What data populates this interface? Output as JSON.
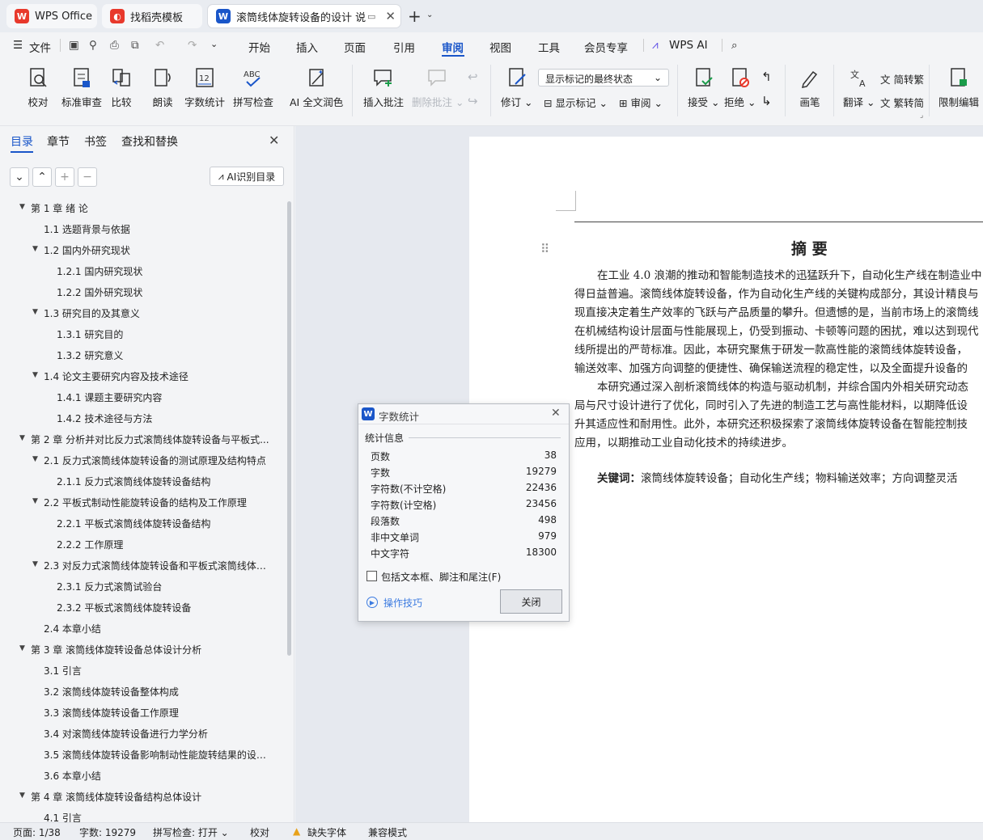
{
  "tabs": [
    {
      "label": "WPS Office",
      "icon": "wps-logo-icon"
    },
    {
      "label": "找稻壳模板",
      "icon": "docer-icon"
    },
    {
      "label": "滚筒线体旋转设备的设计 说明",
      "icon": "writer-doc-icon"
    }
  ],
  "menu": {
    "file": "文件",
    "items": [
      "开始",
      "插入",
      "页面",
      "引用",
      "审阅",
      "视图",
      "工具",
      "会员专享"
    ],
    "ai": "WPS AI"
  },
  "ribbon": {
    "proofread": "校对",
    "std_review": "标准审查",
    "compare": "比较",
    "read_aloud": "朗读",
    "word_count": "字数统计",
    "spell_check": "拼写检查",
    "ai_polish": "AI 全文润色",
    "insert_comment": "插入批注",
    "delete_comment": "删除批注",
    "revise": "修订",
    "markup_select": "显示标记的最终状态",
    "show_markup": "显示标记",
    "review": "审阅",
    "accept": "接受",
    "reject": "拒绝",
    "pen": "画笔",
    "translate": "翻译",
    "to_trad": "简转繁",
    "to_simp": "繁转简",
    "restrict": "限制编辑"
  },
  "nav": {
    "tabs": [
      "目录",
      "章节",
      "书签",
      "查找和替换"
    ],
    "ai_toc": "AI识别目录",
    "toc": [
      {
        "text": "第 1 章  绪    论",
        "level": 1,
        "arrow": true
      },
      {
        "text": "1.1 选题背景与依据",
        "level": 2,
        "arrow": false
      },
      {
        "text": "1.2 国内外研究现状",
        "level": 2,
        "arrow": true
      },
      {
        "text": "1.2.1 国内研究现状",
        "level": 3,
        "arrow": false
      },
      {
        "text": "1.2.2 国外研究现状",
        "level": 3,
        "arrow": false
      },
      {
        "text": "1.3 研究目的及其意义",
        "level": 2,
        "arrow": true
      },
      {
        "text": "1.3.1 研究目的",
        "level": 3,
        "arrow": false
      },
      {
        "text": "1.3.2 研究意义",
        "level": 3,
        "arrow": false
      },
      {
        "text": "1.4  论文主要研究内容及技术途径",
        "level": 2,
        "arrow": true
      },
      {
        "text": "1.4.1  课题主要研究内容",
        "level": 3,
        "arrow": false
      },
      {
        "text": "1.4.2  技术途径与方法",
        "level": 3,
        "arrow": false
      },
      {
        "text": "第 2 章  分析并对比反力式滚筒线体旋转设备与平板式...",
        "level": 1,
        "arrow": true
      },
      {
        "text": "2.1  反力式滚筒线体旋转设备的测试原理及结构特点",
        "level": 2,
        "arrow": true
      },
      {
        "text": "2.1.1  反力式滚筒线体旋转设备结构",
        "level": 3,
        "arrow": false
      },
      {
        "text": "2.2  平板式制动性能旋转设备的结构及工作原理",
        "level": 2,
        "arrow": true
      },
      {
        "text": "2.2.1  平板式滚筒线体旋转设备结构",
        "level": 3,
        "arrow": false
      },
      {
        "text": "2.2.2  工作原理",
        "level": 3,
        "arrow": false
      },
      {
        "text": "2.3 对反力式滚筒线体旋转设备和平板式滚筒线体旋...",
        "level": 2,
        "arrow": true
      },
      {
        "text": "2.3.1  反力式滚筒试验台",
        "level": 3,
        "arrow": false
      },
      {
        "text": "2.3.2  平板式滚筒线体旋转设备",
        "level": 3,
        "arrow": false
      },
      {
        "text": "2.4  本章小结",
        "level": 2,
        "arrow": false
      },
      {
        "text": "第 3 章   滚筒线体旋转设备总体设计分析",
        "level": 1,
        "arrow": true
      },
      {
        "text": "3.1  引言",
        "level": 2,
        "arrow": false
      },
      {
        "text": "3.2 滚筒线体旋转设备整体构成",
        "level": 2,
        "arrow": false
      },
      {
        "text": "3.3  滚筒线体旋转设备工作原理",
        "level": 2,
        "arrow": false
      },
      {
        "text": "3.4  对滚筒线体旋转设备进行力学分析",
        "level": 2,
        "arrow": false
      },
      {
        "text": "3.5  滚筒线体旋转设备影响制动性能旋转结果的设计 ...",
        "level": 2,
        "arrow": false
      },
      {
        "text": "3.6  本章小结",
        "level": 2,
        "arrow": false
      },
      {
        "text": "第 4 章  滚筒线体旋转设备结构总体设计",
        "level": 1,
        "arrow": true
      },
      {
        "text": "4.1  引言",
        "level": 2,
        "arrow": false
      }
    ]
  },
  "doc": {
    "heading": "摘  要",
    "lines": [
      "在工业 4.0 浪潮的推动和智能制造技术的迅猛跃升下，自动化生产线在制造业中",
      "得日益普遍。滚筒线体旋转设备，作为自动化生产线的关键构成部分，其设计精良与",
      "现直接决定着生产效率的飞跃与产品质量的攀升。但遗憾的是，当前市场上的滚筒线",
      "在机械结构设计层面与性能展现上，仍受到振动、卡顿等问题的困扰，难以达到现代",
      "线所提出的严苛标准。因此，本研究聚焦于研发一款高性能的滚筒线体旋转设备，",
      "输送效率、加强方向调整的便捷性、确保输送流程的稳定性，以及全面提升设备的",
      "本研究通过深入剖析滚筒线体的构造与驱动机制，并综合国内外相关研究动态",
      "局与尺寸设计进行了优化，同时引入了先进的制造工艺与高性能材料，以期降低设",
      "升其适应性和耐用性。此外，本研究还积极探索了滚筒线体旋转设备在智能控制技",
      "应用，以期推动工业自动化技术的持续进步。"
    ],
    "kw_label": "关键词：",
    "kw_text": "滚筒线体旋转设备；自动化生产线；物料输送效率；方向调整灵活"
  },
  "dialog": {
    "title": "字数统计",
    "section": "统计信息",
    "stats": [
      {
        "label": "页数",
        "value": "38"
      },
      {
        "label": "字数",
        "value": "19279"
      },
      {
        "label": "字符数(不计空格)",
        "value": "22436"
      },
      {
        "label": "字符数(计空格)",
        "value": "23456"
      },
      {
        "label": "段落数",
        "value": "498"
      },
      {
        "label": "非中文单词",
        "value": "979"
      },
      {
        "label": "中文字符",
        "value": "18300"
      }
    ],
    "checkbox": "包括文本框、脚注和尾注(F)",
    "tips": "操作技巧",
    "close": "关闭"
  },
  "status": {
    "page": "页面: 1/38",
    "words": "字数: 19279",
    "spell": "拼写检查: 打开",
    "proof": "校对",
    "missing_font": "缺失字体",
    "compat": "兼容模式"
  },
  "colors": {
    "accent": "#1a56c9",
    "wps_red": "#e8392c",
    "bg": "#f3f4f6",
    "doc_bg": "#e6e9ef"
  }
}
